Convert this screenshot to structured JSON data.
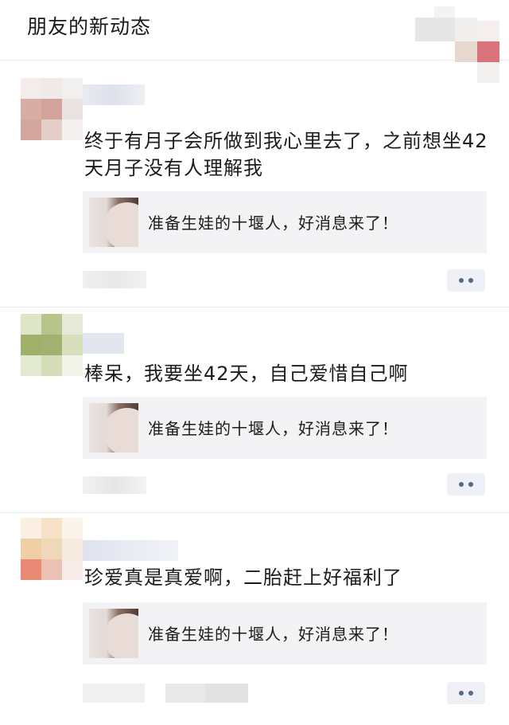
{
  "header": {
    "title": "朋友的新动态"
  },
  "posts": [
    {
      "text": "终于有月子会所做到我心里去了，之前想坐42天月子没有人理解我",
      "link_title": "准备生娃的十堰人，好消息来了！"
    },
    {
      "text": "棒呆，我要坐42天，自己爱惜自己啊",
      "link_title": "准备生娃的十堰人，好消息来了！"
    },
    {
      "text": "珍爱真是真爱啊，二胎赶上好福利了",
      "link_title": "准备生娃的十堰人，好消息来了！"
    }
  ],
  "icons": {
    "more": "more-dots-icon",
    "link_thumbnail": "link-thumbnail-image"
  }
}
